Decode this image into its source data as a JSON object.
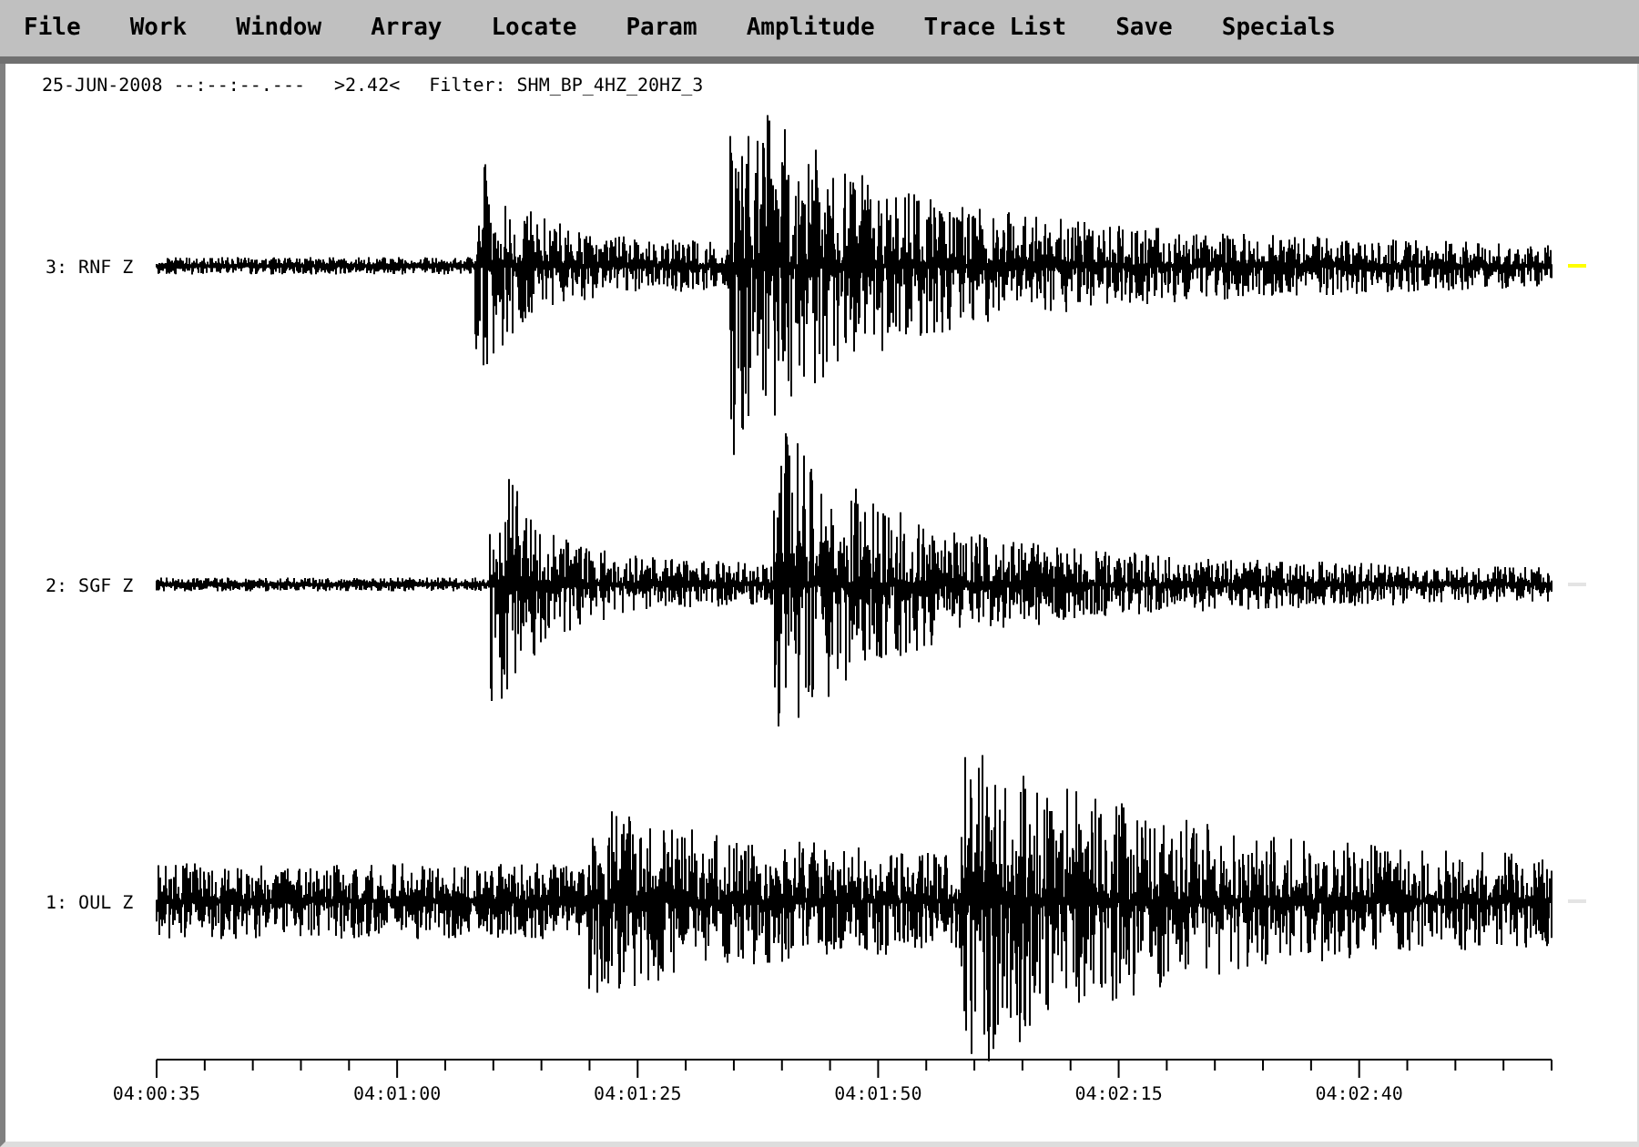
{
  "menu": [
    "File",
    "Work",
    "Window",
    "Array",
    "Locate",
    "Param",
    "Amplitude",
    "Trace List",
    "Save",
    "Specials"
  ],
  "header": {
    "date": "25-JUN-2008 --:--:--.---",
    "scale": ">2.42<",
    "filter": "Filter: SHM_BP_4HZ_20HZ_3"
  },
  "traces": [
    {
      "label": "3: RNF Z",
      "marked": true
    },
    {
      "label": "2: SGF Z",
      "marked": false
    },
    {
      "label": "1: OUL Z",
      "marked": false
    }
  ],
  "time_axis": {
    "labels": [
      "04:00:35",
      "04:01:00",
      "04:01:25",
      "04:01:50",
      "04:02:15",
      "04:02:40"
    ]
  }
}
